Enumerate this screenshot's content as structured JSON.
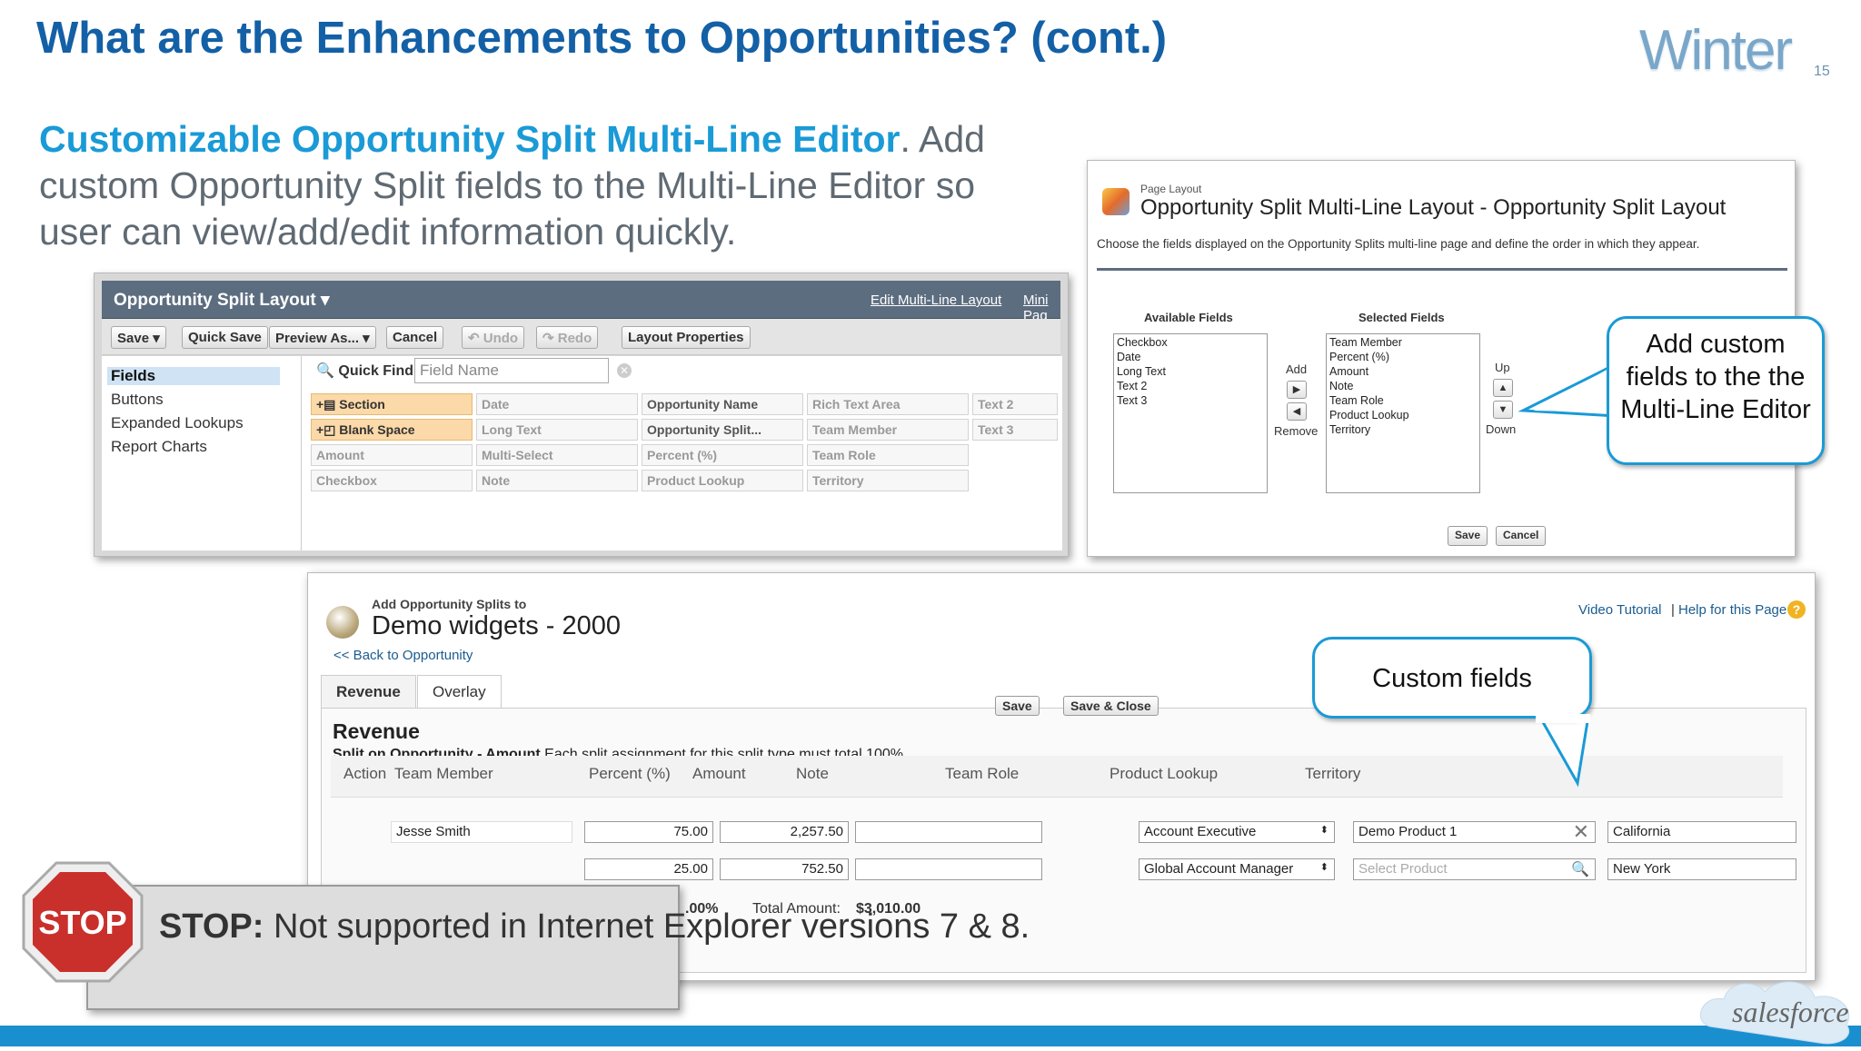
{
  "slide": {
    "title": "What are the Enhancements to Opportunities? (cont.)",
    "logo_text": "Winter",
    "logo_num": "15",
    "intro_highlight": "Customizable Opportunity Split Multi-Line Editor",
    "intro_rest": ". Add custom Opportunity Split fields to the Multi-Line Editor so user can view/add/edit information quickly.",
    "footer_logo": "salesforce"
  },
  "layout_editor": {
    "header_title": "Opportunity Split Layout ▾",
    "header_link1": "Edit Multi-Line Layout",
    "header_link2": "Mini Pag",
    "toolbar": [
      "Save ▾",
      "Quick Save",
      "Preview As... ▾",
      "Cancel",
      "↶ Undo",
      "↷ Redo",
      "Layout Properties"
    ],
    "sidebar": [
      "Fields",
      "Buttons",
      "Expanded Lookups",
      "Report Charts"
    ],
    "quick_find_label": "Quick Find",
    "quick_find_placeholder": "Field Name",
    "fields": {
      "col1": [
        "Section",
        "Blank Space",
        "Amount",
        "Checkbox"
      ],
      "col2": [
        "Date",
        "Long Text",
        "Multi-Select",
        "Note"
      ],
      "col3": [
        "Opportunity Name",
        "Opportunity Split...",
        "Percent (%)",
        "Product Lookup"
      ],
      "col4": [
        "Rich Text Area",
        "Team Member",
        "Team Role",
        "Territory"
      ],
      "col5": [
        "Text 2",
        "Text 3"
      ]
    }
  },
  "multi_line_layout": {
    "page_label": "Page Layout",
    "title": "Opportunity Split Multi-Line Layout - Opportunity Split Layout",
    "description": "Choose the fields displayed on the Opportunity Splits multi-line page and define the order in which they appear.",
    "available_label": "Available Fields",
    "available": [
      "Checkbox",
      "Date",
      "Long Text",
      "Text 2",
      "Text 3"
    ],
    "selected_label": "Selected Fields",
    "selected": [
      "Team Member",
      "Percent (%)",
      "Amount",
      "Note",
      "Team Role",
      "Product Lookup",
      "Territory"
    ],
    "add_label": "Add",
    "remove_label": "Remove",
    "up_label": "Up",
    "down_label": "Down",
    "save": "Save",
    "cancel": "Cancel"
  },
  "splits_page": {
    "subtitle": "Add Opportunity Splits to",
    "title": "Demo widgets - 2000",
    "back_link": "<< Back to Opportunity",
    "help1": "Video Tutorial",
    "help_sep": "|",
    "help2": "Help for this Page",
    "tabs": [
      "Revenue",
      "Overlay"
    ],
    "save": "Save",
    "save_close": "Save & Close",
    "section_title": "Revenue",
    "split_on_bold": "Split on Opportunity - Amount",
    "split_on_rest": "Each split assignment for this split type must total 100%.",
    "columns": [
      "Action",
      "Team Member",
      "Percent (%)",
      "Amount",
      "Note",
      "Team Role",
      "Product Lookup",
      "Territory"
    ],
    "rows": [
      {
        "member": "Jesse Smith",
        "percent": "75.00",
        "amount": "2,257.50",
        "note": "",
        "role": "Account Executive",
        "product": "Demo Product 1",
        "territory": "California"
      },
      {
        "member": "",
        "percent": "25.00",
        "amount": "752.50",
        "note": "",
        "role": "Global Account Manager",
        "product": "Select Product",
        "territory": "New York"
      }
    ],
    "total_percent": ".00%",
    "total_amount_label": "Total Amount:",
    "total_amount": "$3,010.00"
  },
  "callouts": {
    "add_custom": "Add custom fields to the the Multi-Line Editor",
    "custom_fields": "Custom fields"
  },
  "stop": {
    "sign": "STOP",
    "bold": "STOP:",
    "text": " Not supported in Internet Explorer versions 7 & 8."
  }
}
